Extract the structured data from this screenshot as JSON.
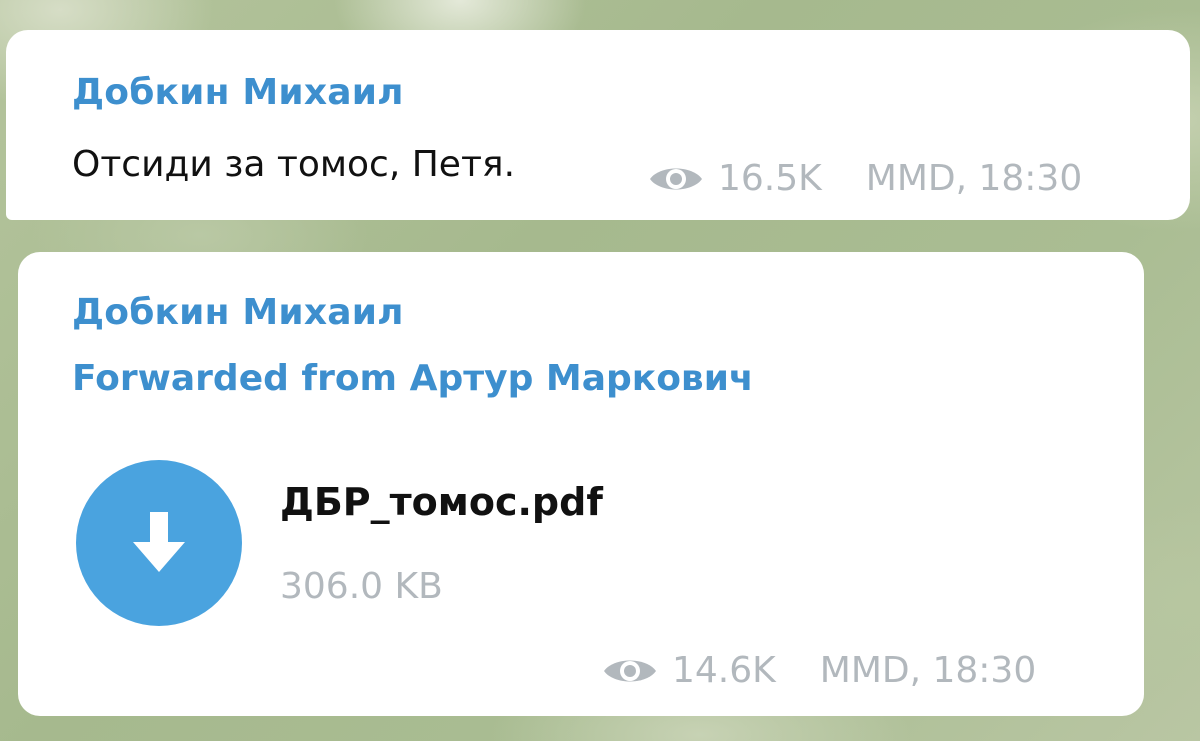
{
  "messages": [
    {
      "sender": "Добкин Михаил",
      "text": "Отсиди за томос, Петя.",
      "views": "16.5K",
      "meta": "MMD, 18:30",
      "views_icon": "eye-icon"
    },
    {
      "sender": "Добкин Михаил",
      "forwarded": "Forwarded from Артур Маркович",
      "file": {
        "name": "ДБР_томос.pdf",
        "size": "306.0 KB",
        "icon": "download-arrow-icon"
      },
      "views": "14.6K",
      "meta": "MMD, 18:30",
      "views_icon": "eye-icon"
    }
  ],
  "colors": {
    "accent": "#3d8fce",
    "file_circle": "#4aa3df",
    "meta_text": "#b2b8bd",
    "bubble": "#ffffff"
  }
}
